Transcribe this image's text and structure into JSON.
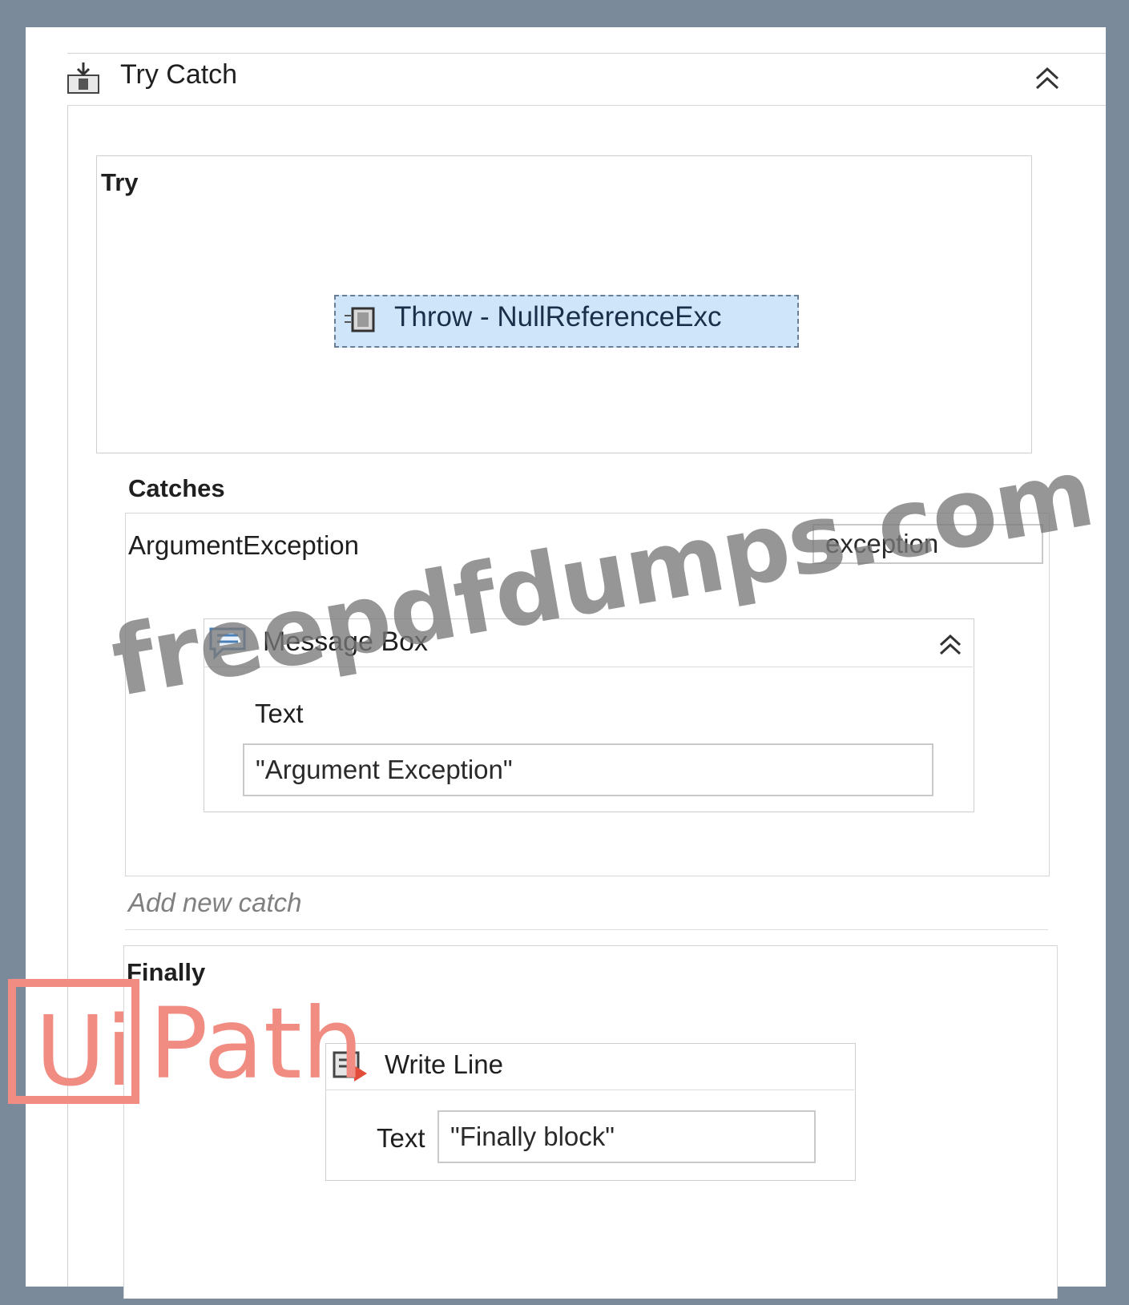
{
  "try_catch": {
    "title": "Try Catch",
    "try_label": "Try",
    "throw_activity": "Throw - NullReferenceExc",
    "catches_label": "Catches",
    "catch": {
      "exception_type": "ArgumentException",
      "variable": "exception",
      "message_box": {
        "title": "Message Box",
        "text_label": "Text",
        "text_value": "\"Argument Exception\""
      }
    },
    "add_catch_label": "Add new catch",
    "finally_label": "Finally",
    "write_line": {
      "title": "Write Line",
      "text_label": "Text",
      "text_value": "\"Finally block\""
    }
  },
  "watermarks": {
    "site": "freepdfdumps.com",
    "logo_ui": "Ui",
    "logo_path": "Path"
  },
  "colors": {
    "frame": "#7b8a9b",
    "selection_fill": "#cfe6fa",
    "selection_border": "#6a7f95",
    "watermark_grey": "#787878",
    "logo_coral": "#f08c82"
  },
  "icons": {
    "try_catch": "try-catch-icon",
    "collapse": "double-chevron-up-icon",
    "throw": "throw-icon",
    "message_box": "message-box-icon",
    "write_line": "write-line-icon"
  }
}
